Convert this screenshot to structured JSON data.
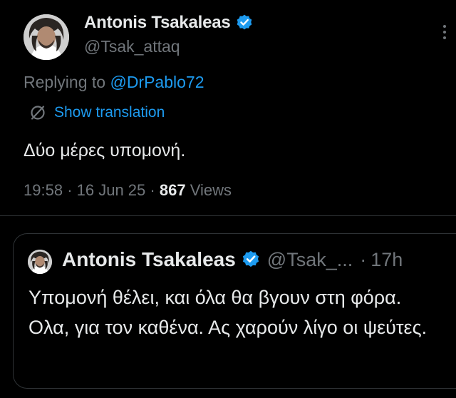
{
  "tweet": {
    "author": {
      "display_name": "Antonis Tsakaleas",
      "handle": "@Tsak_attaq",
      "verified": true,
      "avatar_icon": "profile-photo"
    },
    "replying_prefix": "Replying to ",
    "replying_to": "@DrPablo72",
    "translation_label": "Show translation",
    "text": "Δύο μέρες υπομονή.",
    "time": "19:58",
    "date": "16 Jun 25",
    "views_count": "867",
    "views_label": "Views"
  },
  "quoted_tweet": {
    "author": {
      "display_name": "Antonis Tsakaleas",
      "handle": "@Tsak_...",
      "verified": true
    },
    "separator": "·",
    "time_ago": "17h",
    "text": "Υπομονή θέλει, και όλα θα βγουν στη φόρα. Ολα, για τον καθένα. Ας χαρούν λίγο οι ψεύτες."
  },
  "colors": {
    "background": "#000000",
    "primary_text": "#e7e9ea",
    "secondary_text": "#71767b",
    "accent": "#1d9bf0",
    "border": "#2f3336"
  }
}
